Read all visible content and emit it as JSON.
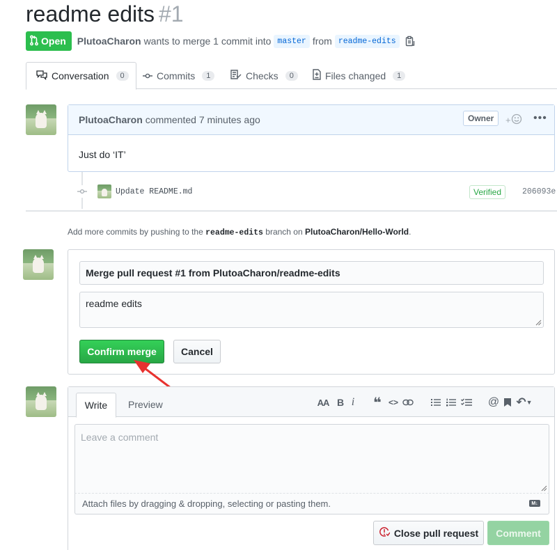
{
  "pr": {
    "title": "readme edits",
    "number": "#1",
    "state": "Open",
    "author": "PlutoaCharon",
    "merge_text": "wants to merge 1 commit into",
    "base_branch": "master",
    "from_text": "from",
    "head_branch": "readme-edits"
  },
  "tabs": [
    {
      "label": "Conversation",
      "count": "0"
    },
    {
      "label": "Commits",
      "count": "1"
    },
    {
      "label": "Checks",
      "count": "0"
    },
    {
      "label": "Files changed",
      "count": "1"
    }
  ],
  "comment": {
    "author": "PlutoaCharon",
    "action": "commented 7 minutes ago",
    "badge": "Owner",
    "dots": "•••",
    "body": "Just do ‘IT’"
  },
  "commit": {
    "message": "Update README.md",
    "verified": "Verified",
    "sha": "206093e"
  },
  "hint": {
    "prefix": "Add more commits by pushing to the",
    "branch": "readme-edits",
    "middle": "branch on",
    "repo": "PlutoaCharon/Hello-World",
    "suffix": "."
  },
  "merge": {
    "title_value": "Merge pull request #1 from PlutoaCharon/readme-edits",
    "message_value": "readme edits",
    "confirm_label": "Confirm merge",
    "cancel_label": "Cancel"
  },
  "new_comment": {
    "write_tab": "Write",
    "preview_tab": "Preview",
    "placeholder": "Leave a comment",
    "attach_text": "Attach files by dragging & dropping, selecting or pasting them.",
    "md_label": "M↓",
    "close_label": "Close pull request",
    "comment_label": "Comment"
  },
  "toolbar": {
    "heading": "AA",
    "bold": "B",
    "italic": "i",
    "quote": "❝",
    "code": "<>",
    "at": "@",
    "reply": "↶"
  },
  "colors": {
    "open_green": "#2cbe4e",
    "link_blue": "#0366d6",
    "arrow_red": "#e8322f",
    "confirm_green": "#28a745"
  }
}
